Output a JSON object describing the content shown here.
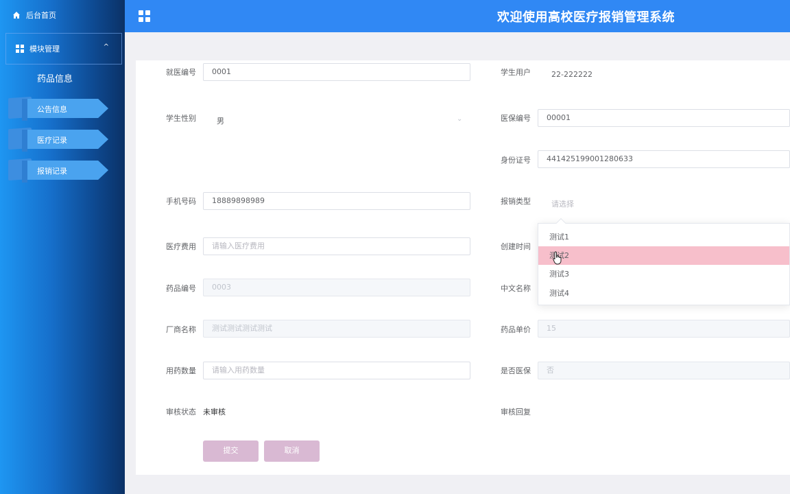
{
  "sidebar": {
    "home_label": "后台首页",
    "module_label": "模块管理",
    "submenu_item": "药品信息",
    "items": [
      {
        "label": "公告信息"
      },
      {
        "label": "医疗记录"
      },
      {
        "label": "报销记录"
      }
    ]
  },
  "header": {
    "title": "欢迎使用高校医疗报销管理系统"
  },
  "form": {
    "visit_no": {
      "label": "就医编号",
      "value": "0001"
    },
    "student_user": {
      "label": "学生用户",
      "value": "22-222222"
    },
    "gender": {
      "label": "学生性别",
      "value": "男"
    },
    "insurance_no": {
      "label": "医保编号",
      "value": "00001"
    },
    "id_card": {
      "label": "身份证号",
      "value": "441425199001280633"
    },
    "phone": {
      "label": "手机号码",
      "value": "18889898989"
    },
    "reimburse_type": {
      "label": "报销类型",
      "placeholder": "请选择",
      "options": [
        "测试1",
        "测试2",
        "测试3",
        "测试4"
      ],
      "hovered": "测试2"
    },
    "medical_fee": {
      "label": "医疗费用",
      "placeholder": "请输入医疗费用"
    },
    "create_time": {
      "label": "创建时间"
    },
    "drug_no": {
      "label": "药品编号",
      "value": "0003"
    },
    "cn_name": {
      "label": "中文名称"
    },
    "manufacturer": {
      "label": "厂商名称",
      "value": "测试测试测试测试"
    },
    "unit_price": {
      "label": "药品单价",
      "value": "15"
    },
    "quantity": {
      "label": "用药数量",
      "placeholder": "请输入用药数量"
    },
    "is_insured": {
      "label": "是否医保",
      "value": "否"
    },
    "audit_status": {
      "label": "审核状态",
      "value": "未审核"
    },
    "audit_reply": {
      "label": "审核回复"
    }
  },
  "buttons": {
    "submit": "提交",
    "cancel": "取消"
  },
  "colors": {
    "header": "#3088f4",
    "button": "#d9b9d3",
    "option_hover": "#f7bfcb"
  }
}
